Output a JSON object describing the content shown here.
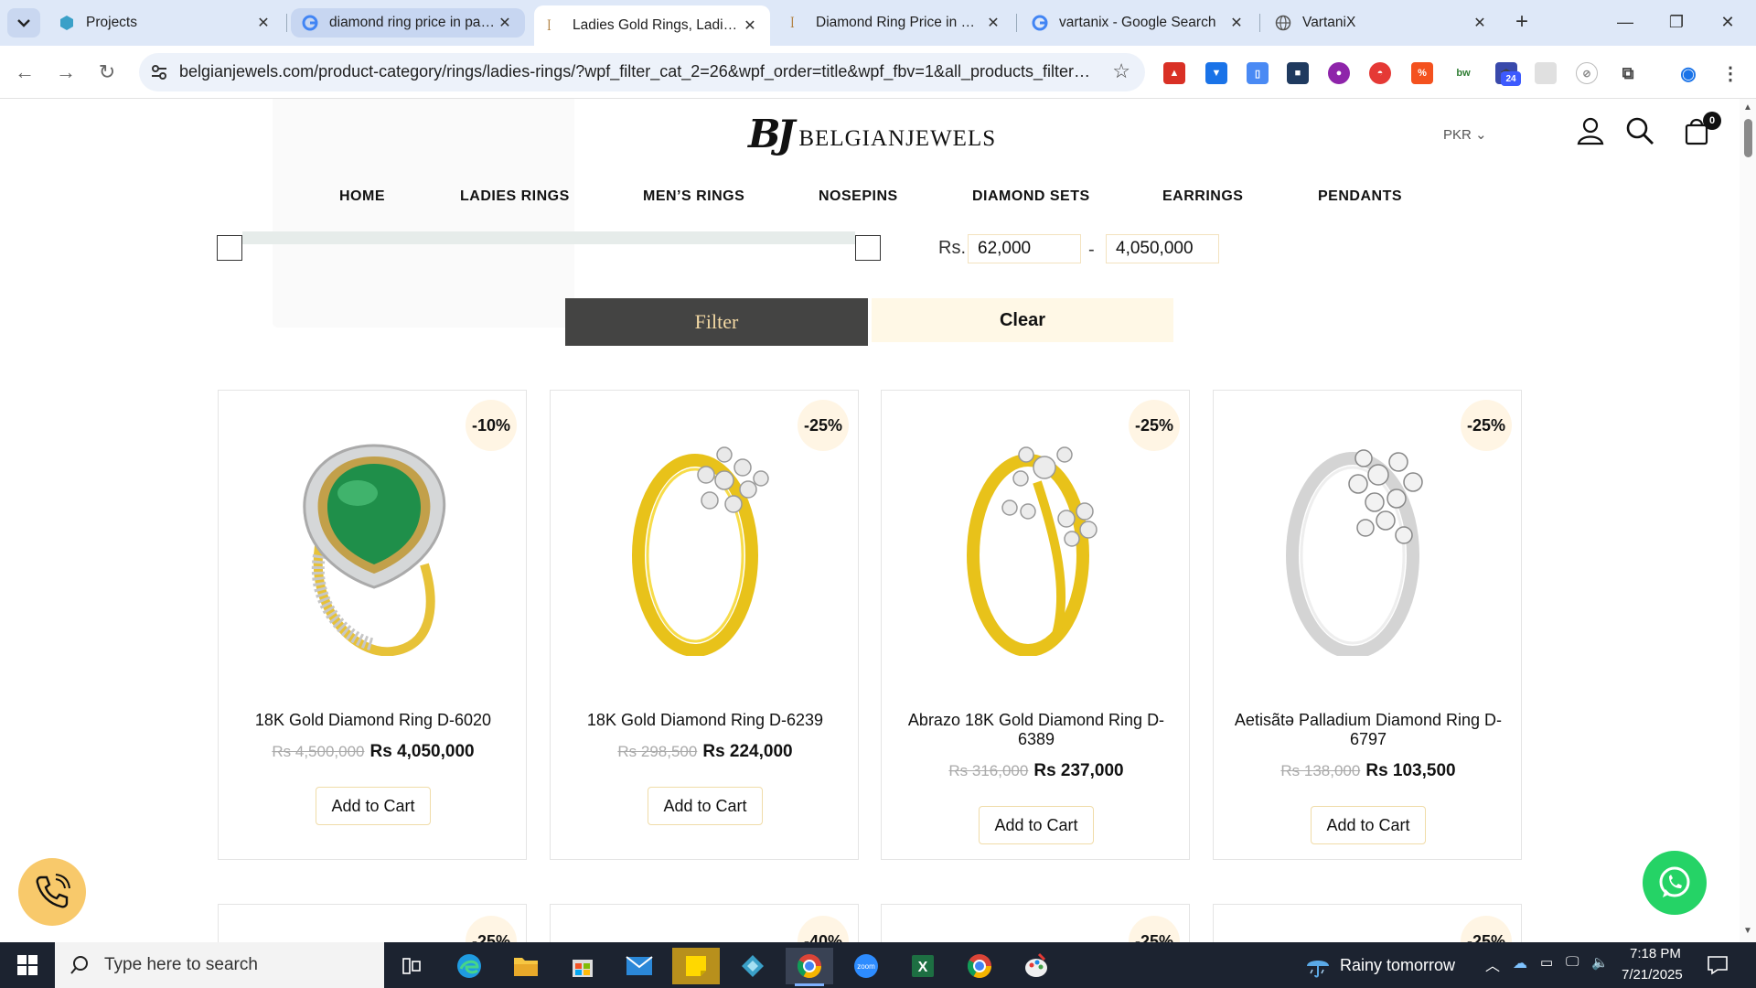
{
  "browser": {
    "tabs": [
      {
        "title": "Projects",
        "favicon": "projects-icon"
      },
      {
        "title": "diamond ring price in pakistan - Google Search",
        "favicon": "google-icon"
      },
      {
        "title": "Ladies Gold Rings, Ladies Diamond Rings",
        "favicon": "belgian-icon"
      },
      {
        "title": "Diamond Ring Price in Pakistan",
        "favicon": "belgian-icon"
      },
      {
        "title": "vartanix - Google Search",
        "favicon": "google-icon"
      },
      {
        "title": "VartaniX",
        "favicon": "globe-icon"
      }
    ],
    "url": "belgianjewels.com/product-category/rings/ladies-rings/?wpf_filter_cat_2=26&wpf_order=title&wpf_fbv=1&all_products_filterin...",
    "extension_badge": "24"
  },
  "site": {
    "logo_mark": "BJ",
    "logo_text": "BELGIANJEWELS",
    "currency": "PKR",
    "cart_count": "0",
    "nav": [
      "HOME",
      "LADIES RINGS",
      "MEN’S RINGS",
      "NOSEPINS",
      "DIAMOND SETS",
      "EARRINGS",
      "PENDANTS"
    ]
  },
  "filter": {
    "currency_label": "Rs.",
    "min": "62,000",
    "max": "4,050,000",
    "dash": "-",
    "filter_label": "Filter",
    "clear_label": "Clear"
  },
  "products": [
    {
      "badge": "-10%",
      "name": "18K Gold Diamond Ring D-6020",
      "old_price": "Rs 4,500,000",
      "new_price": "Rs 4,050,000",
      "cta": "Add to Cart",
      "metal": "gold-emerald"
    },
    {
      "badge": "-25%",
      "name": "18K Gold Diamond Ring D-6239",
      "old_price": "Rs 298,500",
      "new_price": "Rs 224,000",
      "cta": "Add to Cart",
      "metal": "gold"
    },
    {
      "badge": "-25%",
      "name": "Abrazo 18K Gold Diamond Ring D-6389",
      "old_price": "Rs 316,000",
      "new_price": "Rs 237,000",
      "cta": "Add to Cart",
      "metal": "gold"
    },
    {
      "badge": "-25%",
      "name": "Aetisãtə Palladium Diamond Ring D-6797",
      "old_price": "Rs 138,000",
      "new_price": "Rs 103,500",
      "cta": "Add to Cart",
      "metal": "silver"
    }
  ],
  "next_row_badges": [
    "-25%",
    "-40%",
    "-25%",
    "-25%"
  ],
  "taskbar": {
    "search_placeholder": "Type here to search",
    "weather": "Rainy tomorrow",
    "time": "7:18 PM",
    "date": "7/21/2025"
  },
  "colors": {
    "accent_gold": "#f3d9a4",
    "filter_button": "#444443",
    "badge_bg": "#fff5e4",
    "whatsapp": "#25d366",
    "phone_button": "#f8c96b",
    "taskbar": "#1c2330"
  }
}
